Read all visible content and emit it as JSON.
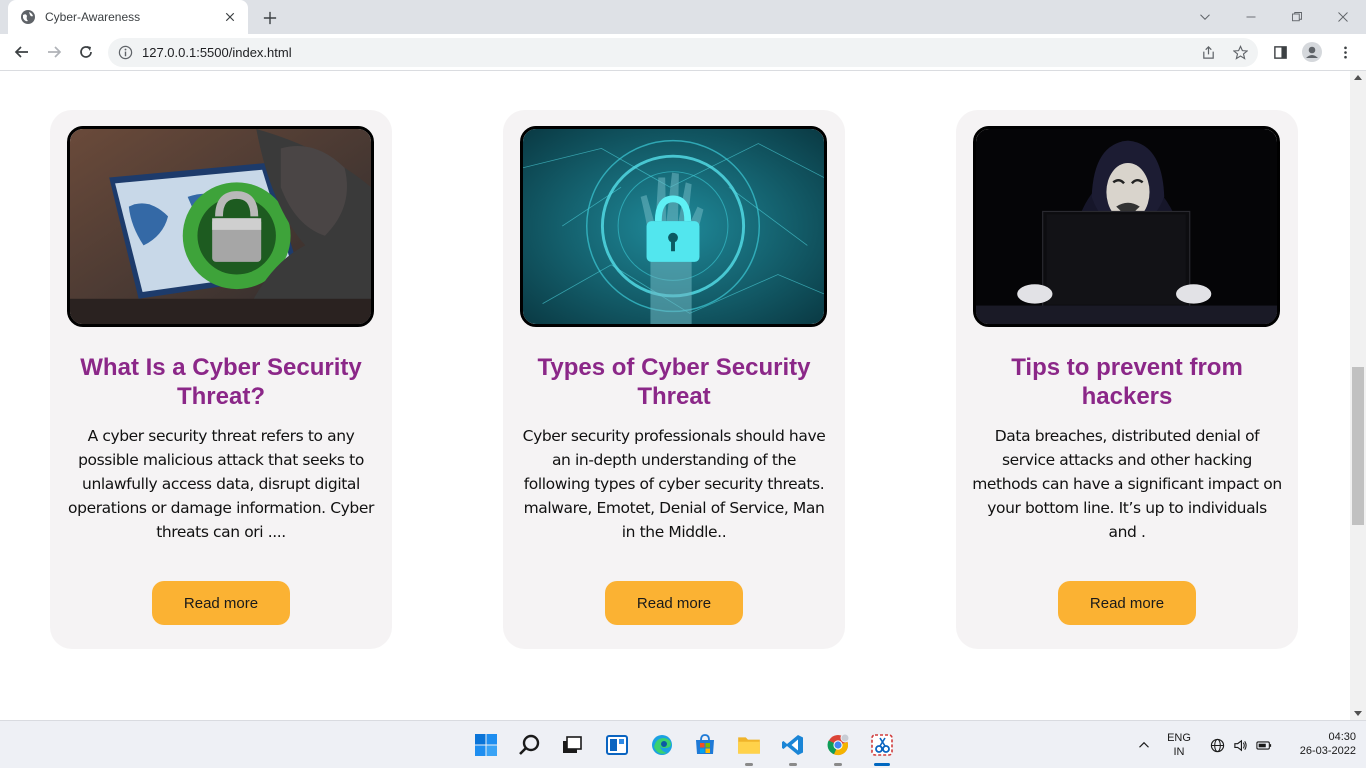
{
  "browser": {
    "tab_title": "Cyber-Awareness",
    "url": "127.0.0.1:5500/index.html"
  },
  "cards": [
    {
      "title": "What Is a Cyber Security Threat?",
      "body": "A cyber security threat refers to any possible malicious attack that seeks to unlawfully access data, disrupt digital operations or damage information. Cyber threats can ori ....",
      "button": "Read more"
    },
    {
      "title": "Types of Cyber Security Threat",
      "body": "Cyber security professionals should have an in-depth understanding of the following types of cyber security threats. malware, Emotet, Denial of Service, Man in the Middle..",
      "button": "Read more"
    },
    {
      "title": "Tips to prevent from hackers",
      "body": "Data breaches, distributed denial of service attacks and other hacking methods can have a significant impact on your bottom line. It’s up to individuals and .",
      "button": "Read more"
    }
  ],
  "taskbar": {
    "lang_line1": "ENG",
    "lang_line2": "IN",
    "time": "04:30",
    "date": "26-03-2022"
  },
  "colors": {
    "card_title": "#8b2788",
    "button": "#fbb233",
    "card_bg": "#f5f3f4"
  }
}
